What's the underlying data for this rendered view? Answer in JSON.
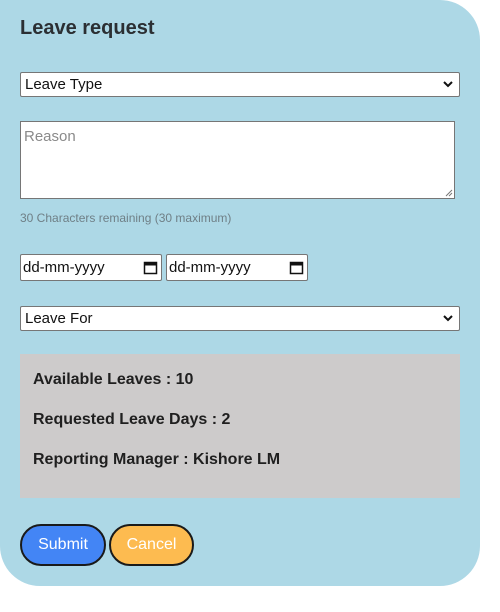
{
  "form": {
    "title": "Leave request",
    "leave_type": {
      "selected": "Leave Type"
    },
    "reason": {
      "placeholder": "Reason",
      "value": ""
    },
    "char_hint": "30 Characters remaining (30 maximum)",
    "start_date": {
      "placeholder": "dd-mm-yyyy"
    },
    "end_date": {
      "placeholder": "dd-mm-yyyy"
    },
    "leave_for": {
      "selected": "Leave For"
    }
  },
  "summary": {
    "available": "Available Leaves : 10",
    "requested": "Requested Leave Days : 2",
    "manager": "Reporting Manager : Kishore LM"
  },
  "buttons": {
    "submit_label": "Submit",
    "cancel_label": "Cancel"
  },
  "colors": {
    "card_bg": "#add8e6",
    "summary_bg": "#cdcbcb",
    "submit_bg": "#4385f5",
    "cancel_bg": "#fdbb50"
  },
  "icons": {
    "select_arrow": "chevron-down-icon",
    "date_picker": "calendar-icon",
    "resize_handle": "resize-grip-icon"
  }
}
